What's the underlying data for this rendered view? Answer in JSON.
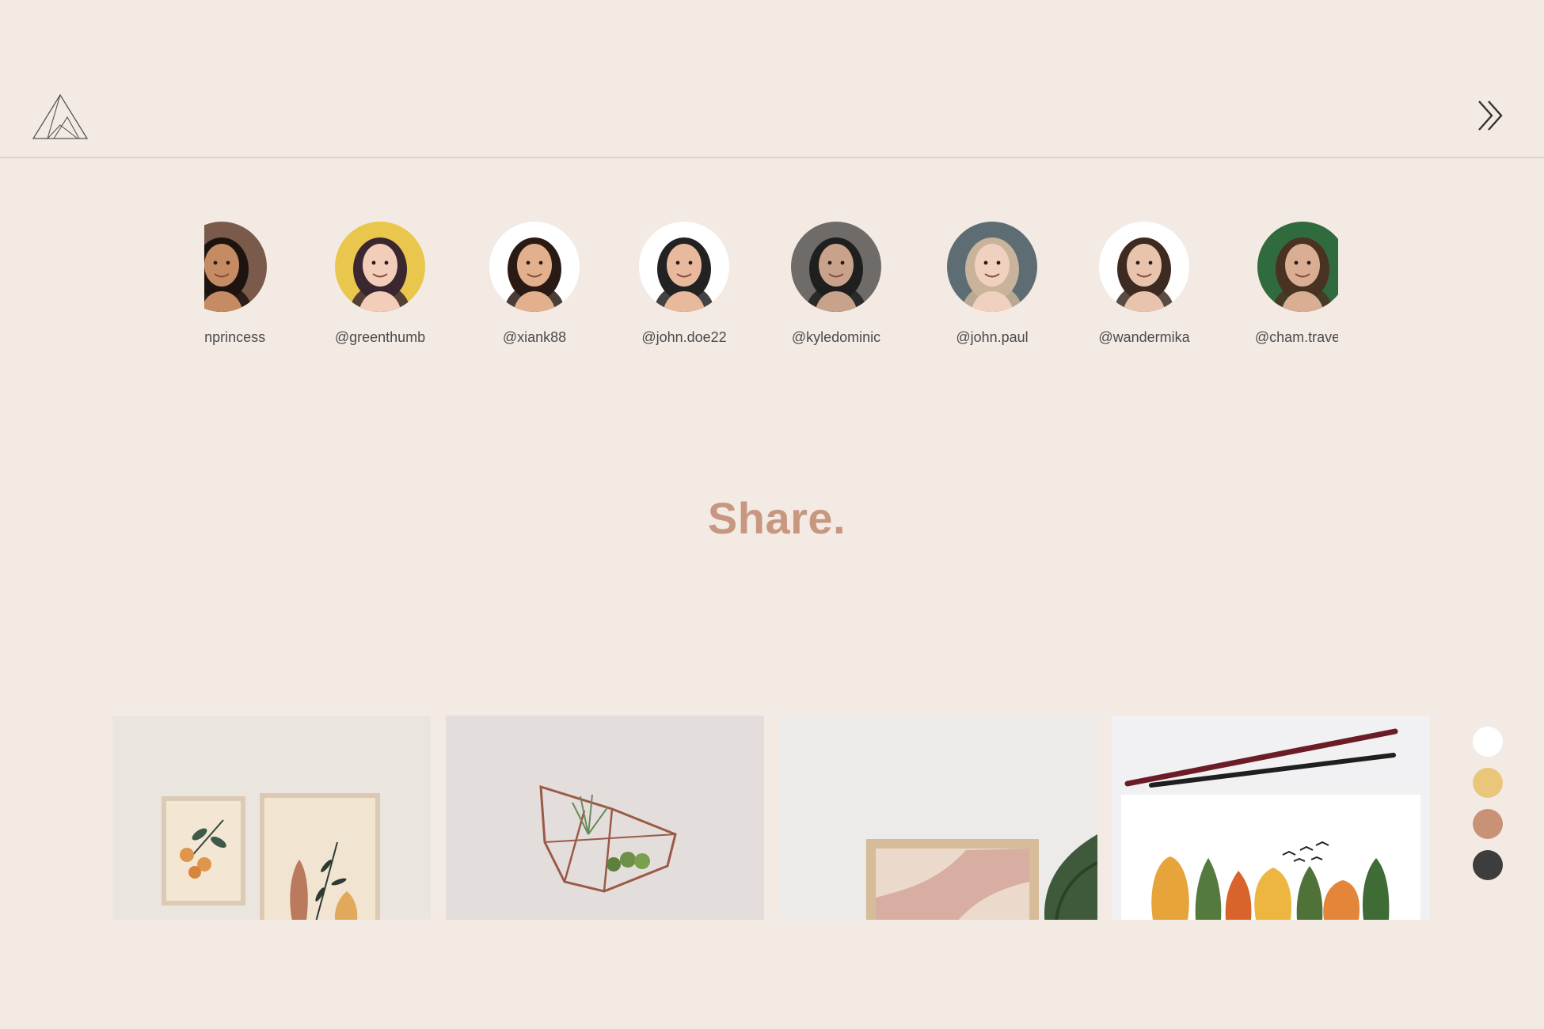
{
  "header": {
    "logo_icon": "triangle-logo-icon",
    "expand_icon": "double-chevron-right-icon"
  },
  "users": [
    {
      "handle": "@mnprincess",
      "avatar_bg": "#7a5a4a",
      "skin": "#c58b62",
      "hair": "#1d1410"
    },
    {
      "handle": "@greenthumb",
      "avatar_bg": "#e9c74c",
      "skin": "#f2cdb9",
      "hair": "#3a2730"
    },
    {
      "handle": "@xiank88",
      "avatar_bg": "#ffffff",
      "skin": "#e3b08e",
      "hair": "#2a1a14"
    },
    {
      "handle": "@john.doe22",
      "avatar_bg": "#ffffff",
      "skin": "#e9b99e",
      "hair": "#222222"
    },
    {
      "handle": "@kyledominic",
      "avatar_bg": "#6e6b68",
      "skin": "#c9a28b",
      "hair": "#1f1f1f"
    },
    {
      "handle": "@john.paul",
      "avatar_bg": "#5d6d73",
      "skin": "#f0d1c0",
      "hair": "#c9b39a"
    },
    {
      "handle": "@wandermika",
      "avatar_bg": "#ffffff",
      "skin": "#e9c4ad",
      "hair": "#3d2b22"
    },
    {
      "handle": "@cham.travels",
      "avatar_bg": "#2f6b3c",
      "skin": "#d9ae92",
      "hair": "#4a3223"
    }
  ],
  "headline": "Share.",
  "gallery": [
    {
      "name": "framed-botanical-prints",
      "bg": "#ebe5e0"
    },
    {
      "name": "glass-terrarium-shelf",
      "bg": "#e3dedb"
    },
    {
      "name": "wood-frame-abstract-print",
      "bg": "#ecebea"
    },
    {
      "name": "autumn-trees-watercolor",
      "bg": "#f1f0f2"
    }
  ],
  "swatches": [
    "#ffffff",
    "#e9c67a",
    "#c99277",
    "#3d3d3d"
  ]
}
